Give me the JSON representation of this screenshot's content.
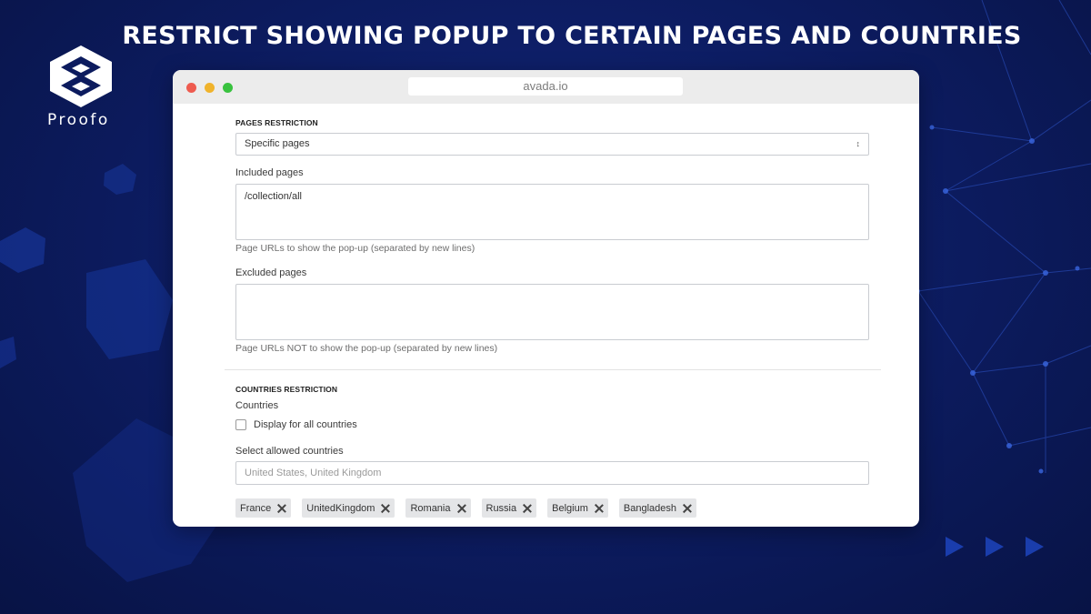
{
  "headline": "RESTRICT SHOWING POPUP TO CERTAIN PAGES AND COUNTRIES",
  "brand": {
    "name": "Proofo"
  },
  "browser": {
    "url": "avada.io"
  },
  "pages_restriction": {
    "title": "PAGES RESTRICTION",
    "select_value": "Specific pages",
    "included_label": "Included pages",
    "included_value": "/collection/all",
    "included_help": "Page URLs to show the pop-up (separated by new lines)",
    "excluded_label": "Excluded pages",
    "excluded_value": "",
    "excluded_help": "Page URLs NOT to show the pop-up (separated by new lines)"
  },
  "countries_restriction": {
    "title": "COUNTRIES RESTRICTION",
    "countries_label": "Countries",
    "display_all_label": "Display for all countries",
    "display_all_checked": false,
    "select_label": "Select allowed countries",
    "input_placeholder": "United States, United Kingdom",
    "tags": [
      "France",
      "UnitedKingdom",
      "Romania",
      "Russia",
      "Belgium",
      "Bangladesh"
    ]
  },
  "colors": {
    "background": "#0c1b5e",
    "accent_blue": "#2a4fd0",
    "traffic_red": "#ee5b4f",
    "traffic_yellow": "#f0b32c",
    "traffic_green": "#39c23f"
  }
}
